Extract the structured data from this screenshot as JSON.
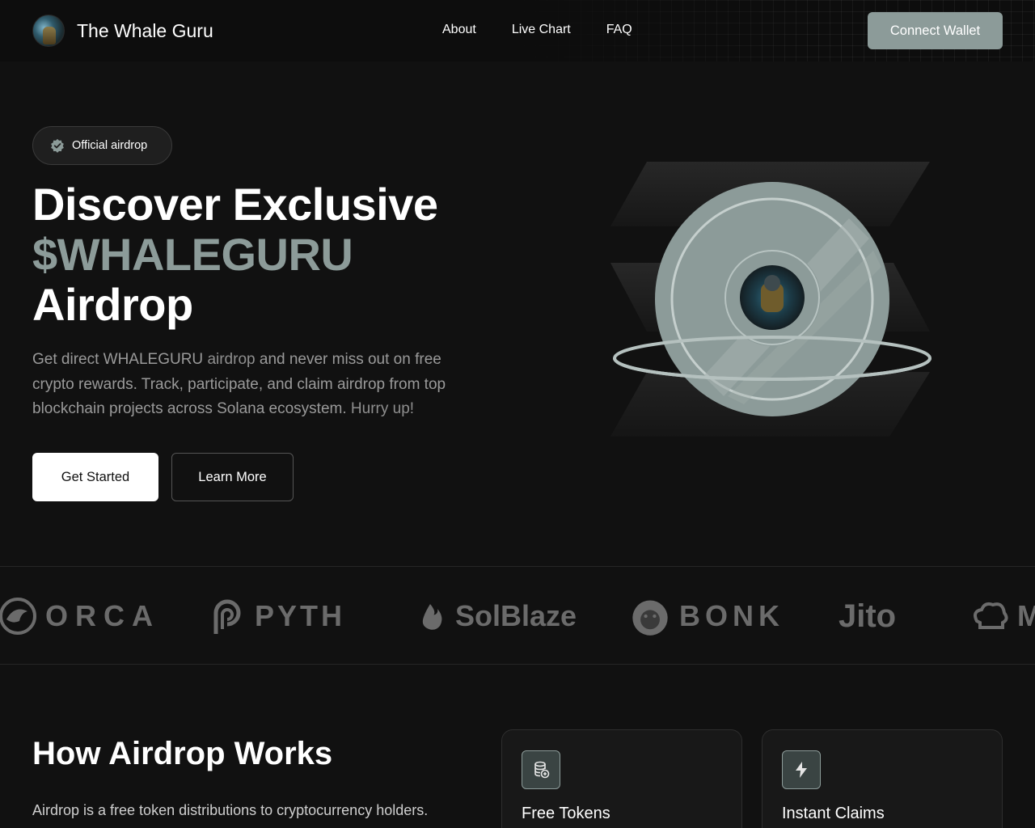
{
  "header": {
    "brand_name": "The Whale Guru",
    "nav": [
      "About",
      "Live Chart",
      "FAQ"
    ],
    "connect_label": "Connect Wallet"
  },
  "hero": {
    "badge": "Official airdrop",
    "title_line1": "Discover Exclusive",
    "title_line2": "$WHALEGURU",
    "title_line3": "Airdrop",
    "desc_a": "Get direct WHALEGURU",
    "desc_b": "airdrop",
    "desc_c": "and never miss out on free crypto rewards. Track, participate, and claim airdrop from top blockchain projects across Solana ecosystem.",
    "desc_d": "Hurry up!",
    "primary_cta": "Get Started",
    "secondary_cta": "Learn More"
  },
  "partners": [
    "ORCA",
    "PYTH",
    "SolBlaze",
    "BONK",
    "Jito",
    "M"
  ],
  "how": {
    "title": "How Airdrop Works",
    "desc": "Airdrop is a free token distributions to cryptocurrency holders.",
    "cards": [
      {
        "title": "Free Tokens",
        "icon": "coins-icon"
      },
      {
        "title": "Instant Claims",
        "icon": "lightning-icon"
      }
    ]
  },
  "colors": {
    "accent": "#8c9b99",
    "background": "#111111"
  }
}
